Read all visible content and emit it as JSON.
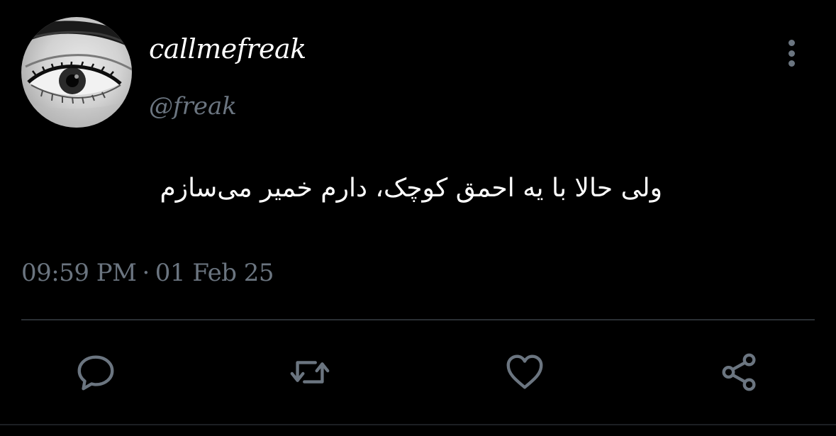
{
  "user": {
    "display_name": "callmefreak",
    "handle": "@freak",
    "avatar_icon": "avatar-eye-photo"
  },
  "tweet": {
    "text": "ولی حالا با یه احمق کوچک، دارم خمیر می‌سازم",
    "time": "09:59 PM",
    "separator": "·",
    "date": "01 Feb 25"
  },
  "actions": [
    {
      "name": "reply",
      "icon": "comment-icon"
    },
    {
      "name": "retweet",
      "icon": "retweet-icon"
    },
    {
      "name": "like",
      "icon": "heart-icon"
    },
    {
      "name": "share",
      "icon": "share-icon"
    }
  ],
  "colors": {
    "background": "#000000",
    "primary_text": "#ffffff",
    "secondary_text": "#6b7580",
    "divider": "#2a2f34"
  }
}
